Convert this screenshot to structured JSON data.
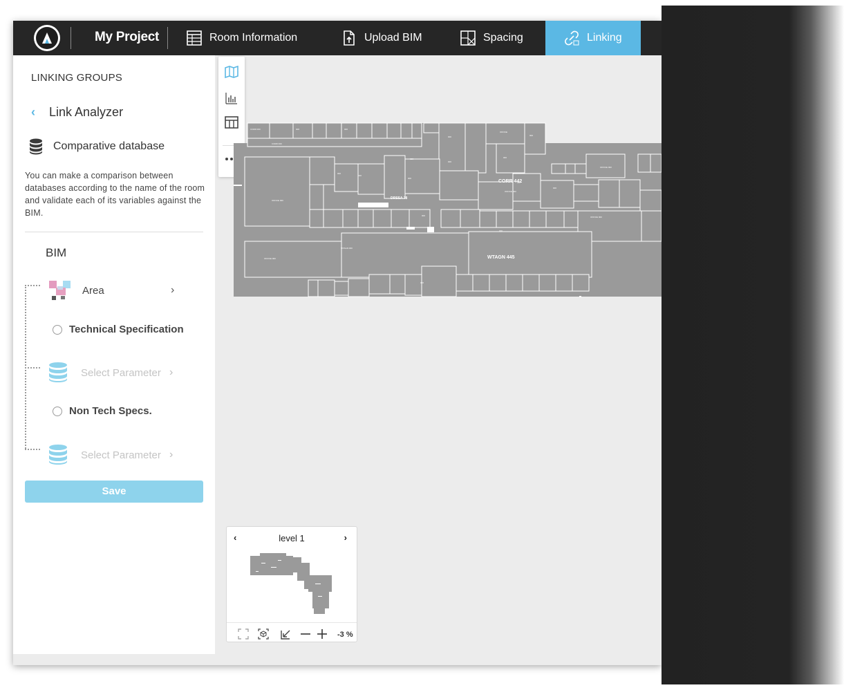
{
  "header": {
    "project_title": "My Project",
    "nav": [
      {
        "label": "Room Information",
        "icon": "table-icon"
      },
      {
        "label": "Upload BIM",
        "icon": "upload-file-icon"
      },
      {
        "label": "Spacing",
        "icon": "spacing-icon"
      },
      {
        "label": "Linking",
        "icon": "link-icon",
        "active": true
      }
    ]
  },
  "panel": {
    "heading": "LINKING GROUPS",
    "back_title": "Link Analyzer",
    "db_title": "Comparative database",
    "description": "You can make a comparison between databases according to the name of the room and validate each of its variables against the BIM.",
    "bim_label": "BIM",
    "area_label": "Area",
    "tech_spec_label": "Technical Specification",
    "select_param_1": "Select Parameter",
    "non_tech_label": "Non Tech Specs.",
    "select_param_2": "Select Parameter",
    "save_label": "Save"
  },
  "plan": {
    "labels": {
      "corr_442": "CORR 442",
      "wtagn_445": "WTAGN 445",
      "dress_78": "DRSSA 78"
    }
  },
  "minimap": {
    "level_label": "level 1",
    "zoom": "-3 %"
  },
  "colors": {
    "accent": "#5bb8e4",
    "topbar": "#262626",
    "save": "#8ed3ec",
    "plan_fill": "#9a9a9a"
  }
}
